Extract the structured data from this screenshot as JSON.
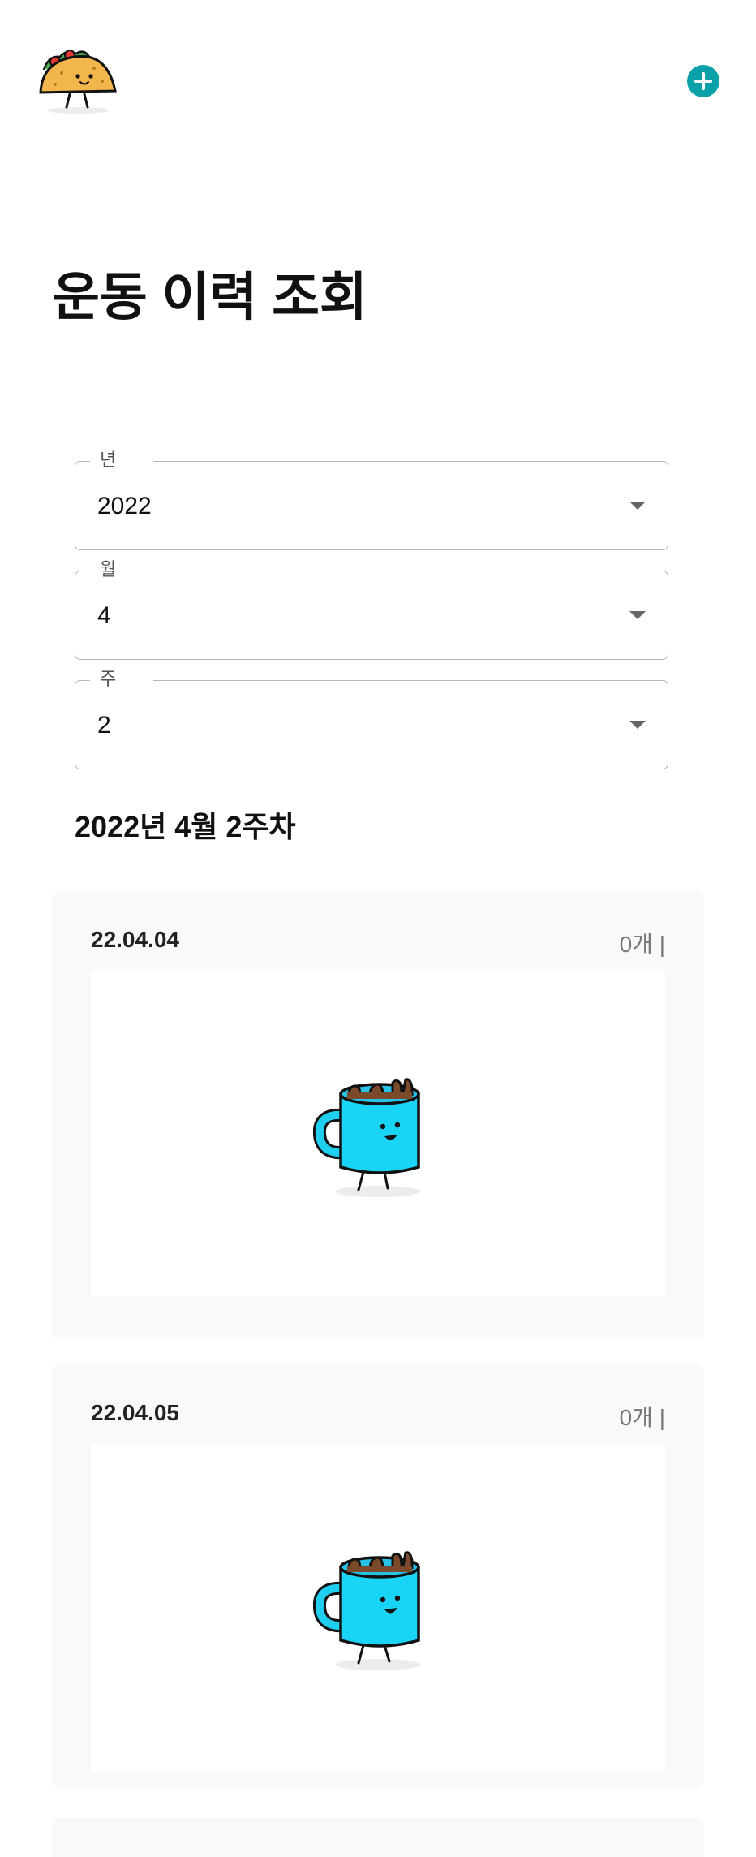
{
  "header": {
    "logo_icon": "taco-mascot-icon",
    "add_icon": "plus-circle-icon",
    "accent_color": "#0aa2a8"
  },
  "page": {
    "title": "운동 이력 조회"
  },
  "filters": {
    "year": {
      "label": "년",
      "value": "2022"
    },
    "month": {
      "label": "월",
      "value": "4"
    },
    "week": {
      "label": "주",
      "value": "2"
    }
  },
  "week_heading": "2022년 4월 2주차",
  "days": [
    {
      "date": "22.04.04",
      "count": "0개 |",
      "empty_icon": "mug-mascot-icon"
    },
    {
      "date": "22.04.05",
      "count": "0개 |",
      "empty_icon": "mug-mascot-icon"
    }
  ]
}
